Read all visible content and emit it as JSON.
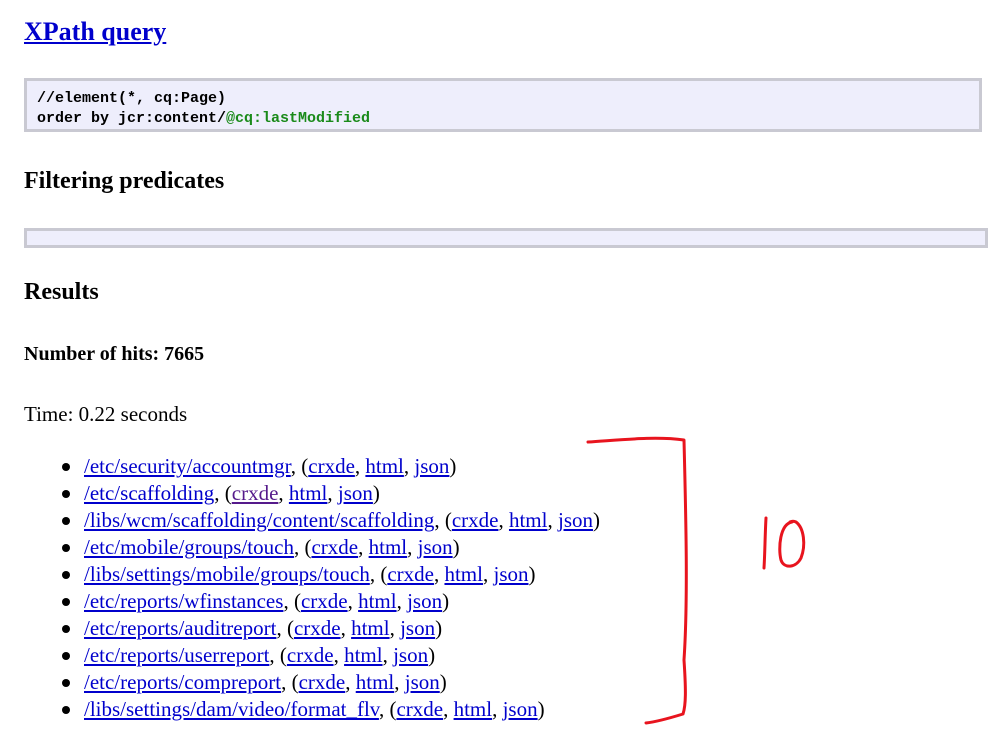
{
  "page": {
    "title": "XPath query",
    "query_line1": "//element(*, cq:Page)",
    "query_line2_prefix": "order by jcr:content/",
    "query_line2_attr": "@cq:lastModified",
    "filtering_heading": "Filtering predicates",
    "results_heading": "Results",
    "hits": "Number of hits: 7665",
    "time": "Time: 0.22 seconds"
  },
  "results": [
    {
      "path": "/etc/security/accountmgr",
      "crxde_visited": false
    },
    {
      "path": "/etc/scaffolding",
      "crxde_visited": true
    },
    {
      "path": "/libs/wcm/scaffolding/content/scaffolding",
      "crxde_visited": false
    },
    {
      "path": "/etc/mobile/groups/touch",
      "crxde_visited": false
    },
    {
      "path": "/libs/settings/mobile/groups/touch",
      "crxde_visited": false
    },
    {
      "path": "/etc/reports/wfinstances",
      "crxde_visited": false
    },
    {
      "path": "/etc/reports/auditreport",
      "crxde_visited": false
    },
    {
      "path": "/etc/reports/userreport",
      "crxde_visited": false
    },
    {
      "path": "/etc/reports/compreport",
      "crxde_visited": false
    },
    {
      "path": "/libs/settings/dam/video/format_flv",
      "crxde_visited": false
    }
  ],
  "link_labels": {
    "crxde": "crxde",
    "html": "html",
    "json": "json"
  },
  "annotation": {
    "text": "10",
    "color": "#e8141e"
  }
}
